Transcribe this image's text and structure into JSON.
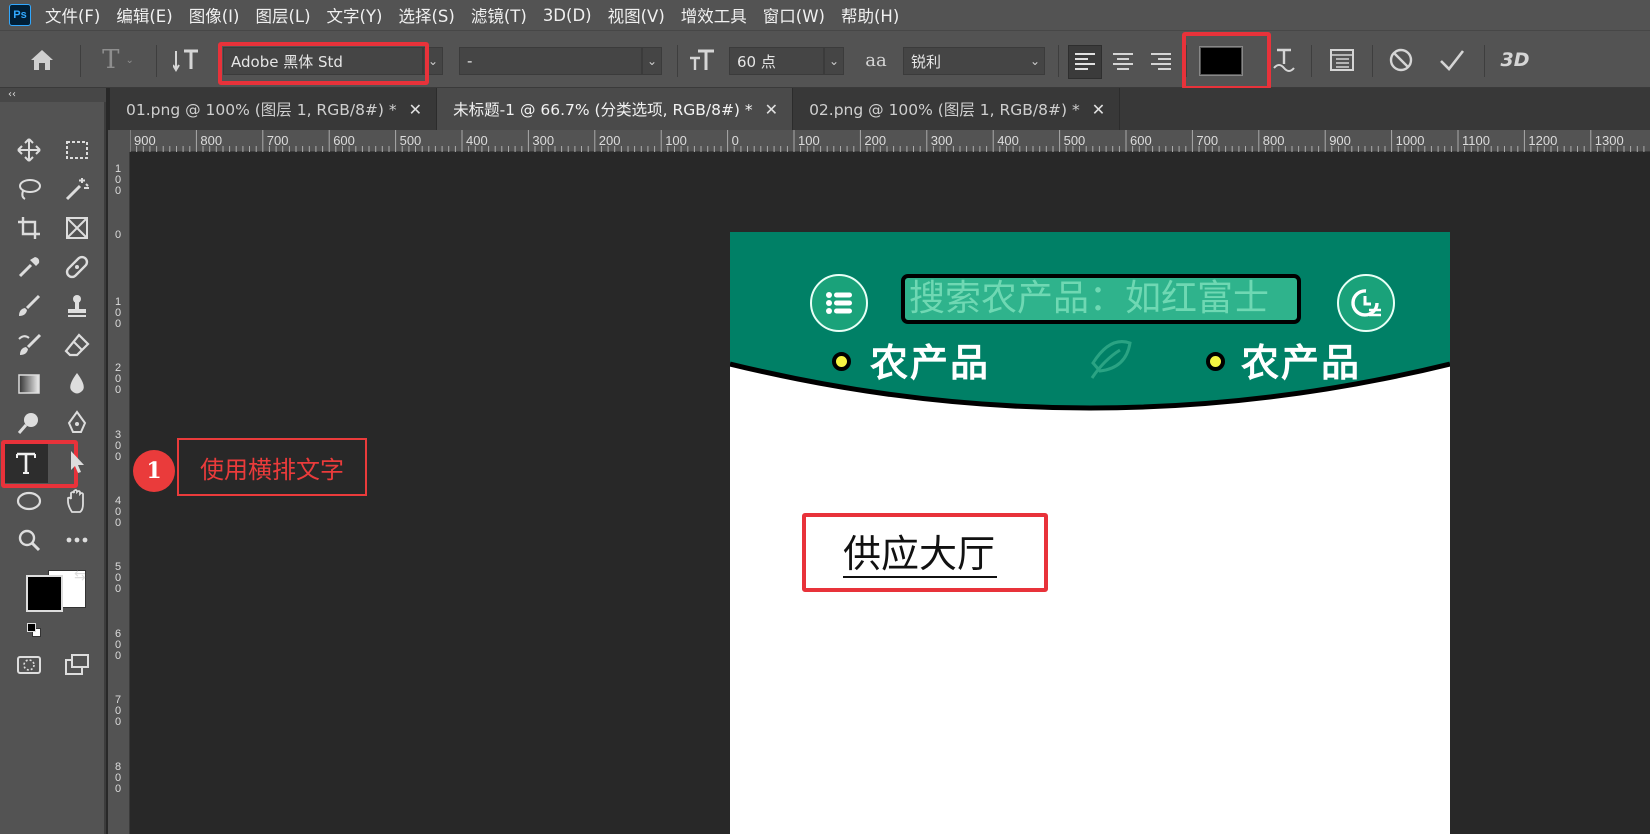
{
  "app": {
    "logo": "Ps"
  },
  "menu": [
    "文件(F)",
    "编辑(E)",
    "图像(I)",
    "图层(L)",
    "文字(Y)",
    "选择(S)",
    "滤镜(T)",
    "3D(D)",
    "视图(V)",
    "增效工具",
    "窗口(W)",
    "帮助(H)"
  ],
  "options": {
    "tool_glyph": "T",
    "font_family": "Adobe 黑体 Std",
    "font_style": "-",
    "font_size": "60 点",
    "aa_glyph": "aa",
    "antialias": "锐利",
    "color_hex": "#000000",
    "threed_label": "3D"
  },
  "toolbar": {
    "collapse": "‹‹"
  },
  "tabs": [
    {
      "title": "01.png @ 100% (图层 1, RGB/8#) *",
      "active": false
    },
    {
      "title": "未标题-1 @ 66.7% (分类选项, RGB/8#) *",
      "active": true
    },
    {
      "title": "02.png @ 100% (图层 1, RGB/8#) *",
      "active": false
    }
  ],
  "ruler_h": [
    "900",
    "800",
    "700",
    "600",
    "500",
    "400",
    "300",
    "200",
    "100",
    "0",
    "100",
    "200",
    "300",
    "400",
    "500",
    "600",
    "700",
    "800",
    "900",
    "1000",
    "1100",
    "1200",
    "1300"
  ],
  "ruler_v": [
    "100",
    "0",
    "100",
    "200",
    "300",
    "400",
    "500",
    "600",
    "700",
    "800"
  ],
  "document": {
    "search_placeholder": "搜索农产品：如红富士",
    "nav_left": "农产品",
    "nav_right": "农产品",
    "text_layer": "供应大厅",
    "header_color": "#008066",
    "search_color": "#2fb38c",
    "dot_color": "#f5f542"
  },
  "callout": {
    "number": "1",
    "text": "使用横排文字"
  },
  "colors": {
    "highlight": "#e8323a",
    "foreground": "#000000",
    "background": "#ffffff"
  }
}
